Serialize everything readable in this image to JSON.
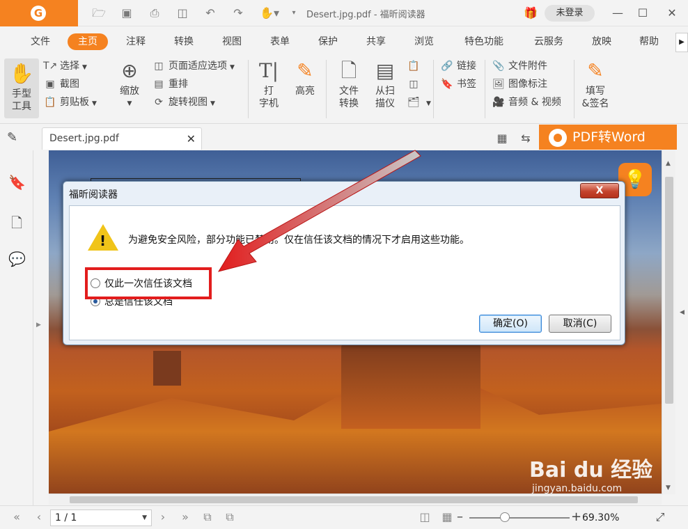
{
  "window": {
    "title": "Desert.jpg.pdf - 福昕阅读器",
    "logo_letter": "G",
    "login": "未登录"
  },
  "menu": [
    "文件",
    "主页",
    "注释",
    "转换",
    "视图",
    "表单",
    "保护",
    "共享",
    "浏览",
    "特色功能",
    "云服务",
    "放映",
    "帮助"
  ],
  "ribbon": {
    "hand_tool": "手型\n工具",
    "select": "选择",
    "snapshot": "截图",
    "clipboard": "剪贴板",
    "zoom": "缩放",
    "page_fit": "页面适应选项",
    "reflow": "重排",
    "rotate": "旋转视图",
    "typewriter": "打\n字机",
    "highlight": "高亮",
    "file_convert": "文件\n转换",
    "from_scanner": "从扫\n描仪",
    "link": "链接",
    "bookmark": "书签",
    "file_attachment": "文件附件",
    "image_annotation": "图像标注",
    "audio_video": "音频 & 视频",
    "fill_sign": "填写\n&签名"
  },
  "tab": {
    "label": "Desert.jpg.pdf"
  },
  "promo": {
    "label": "PDF转Word"
  },
  "dialog": {
    "title": "福昕阅读器",
    "close": "X",
    "message": "为避免安全风险，部分功能已禁用。仅在信任该文档的情况下才启用这些功能。",
    "option_once": "仅此一次信任该文档",
    "option_always": "总是信任该文档",
    "ok": "确定(O)",
    "cancel": "取消(C)"
  },
  "status": {
    "page": "1 / 1",
    "zoom": "69.30%"
  },
  "watermark": {
    "brand": "Bai du 经验",
    "url": "jingyan.baidu.com"
  },
  "colors": {
    "accent": "#f58220",
    "annotation": "#e21d1d"
  }
}
